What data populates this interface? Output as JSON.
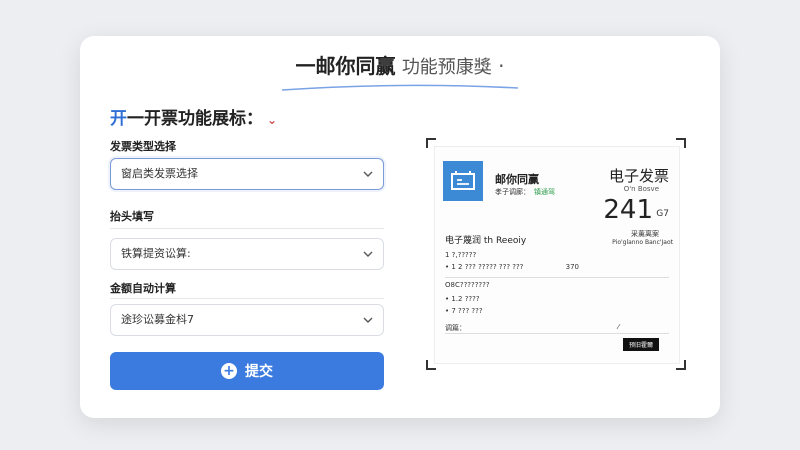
{
  "hero": {
    "title_strong": "一邮你同赢",
    "title_light": "功能预康獎",
    "title_dot": "·"
  },
  "form": {
    "section_title_accent": "开",
    "section_title_rest": "一开票功能展标：",
    "fields": [
      {
        "label": "发票类型选择",
        "value": "窗启类发票选择"
      },
      {
        "label": "抬头填写",
        "value": "铁算提资讼算:"
      },
      {
        "label": "金额自动计算",
        "value": "途珍讼募金枓7"
      }
    ],
    "submit_label": "提交"
  },
  "invoice": {
    "issuer": "邮你同赢",
    "issuer_sub": "孝子调廊：",
    "issuer_ok": "镇通驾",
    "title": "电子发票",
    "code": "O'n Bosve",
    "number": "241",
    "number_suffix": "G7",
    "type": "采薰离案",
    "type2": "Pio'glanno Banc'Jaot",
    "pay_line": "电子蔑润 th Reeoiy",
    "lines": [
      {
        "text": "1 ?,?????",
        "extra": ""
      },
      {
        "text": "• 1 2 ??? ????? ??? ???",
        "extra": "370"
      },
      {
        "text": "O8C????????",
        "extra": ""
      },
      {
        "text": "• 1.2 ????",
        "extra": ""
      },
      {
        "text": "• 7 ??? ???",
        "extra": ""
      },
      {
        "text": "调篇：",
        "extra": "⁄"
      }
    ],
    "tag": "预旧霍爾"
  },
  "colors": {
    "accent": "#3b7be0",
    "logo": "#3c8ad6"
  }
}
